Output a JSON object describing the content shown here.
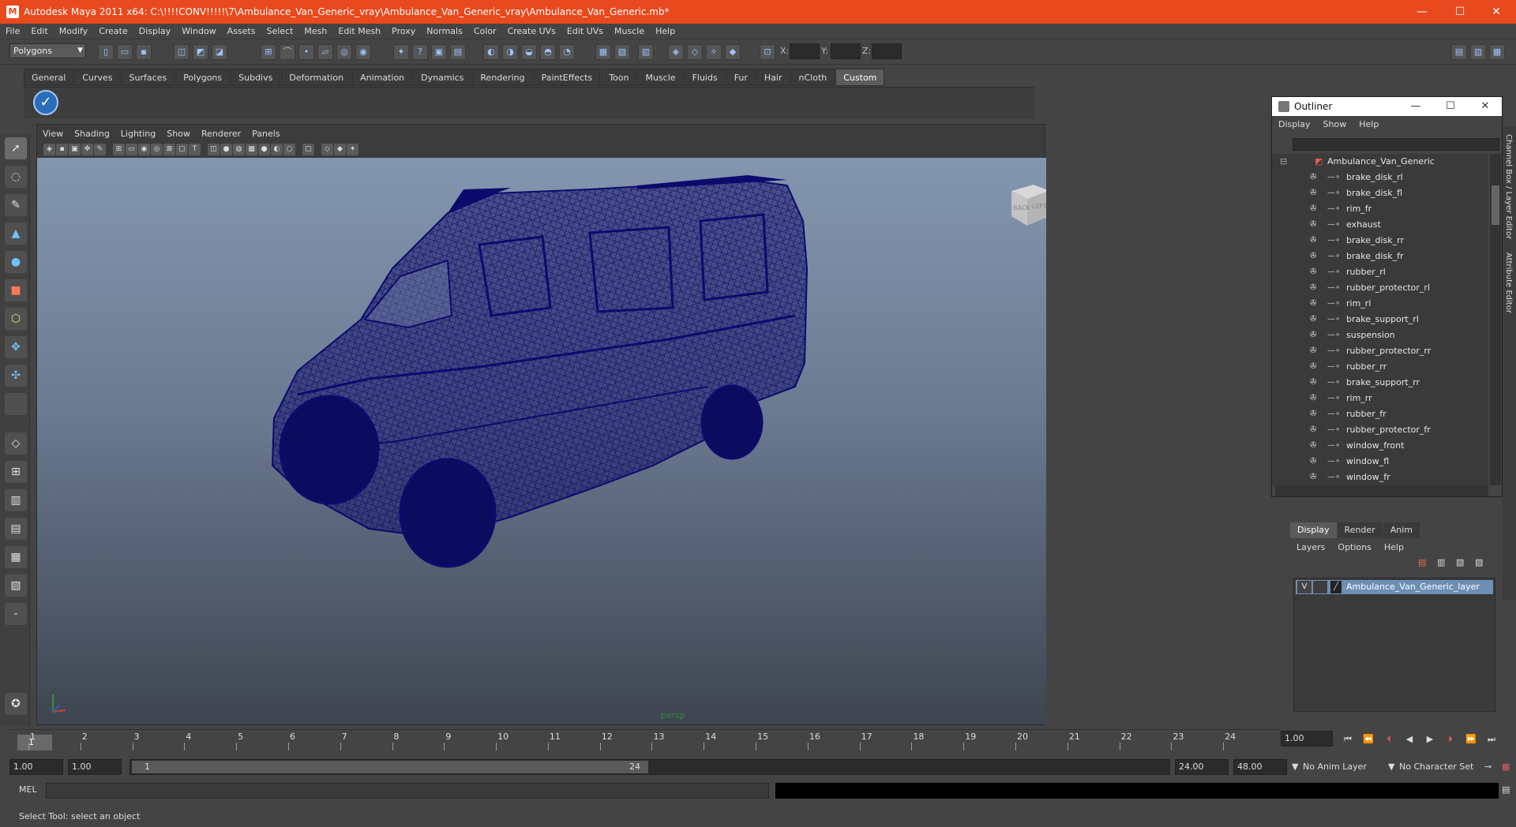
{
  "window": {
    "title": "Autodesk Maya 2011 x64: C:\\!!!!CONV!!!!!\\7\\Ambulance_Van_Generic_vray\\Ambulance_Van_Generic_vray\\Ambulance_Van_Generic.mb*",
    "minimize": "—",
    "maximize": "☐",
    "close": "✕"
  },
  "menubar": [
    "File",
    "Edit",
    "Modify",
    "Create",
    "Display",
    "Window",
    "Assets",
    "Select",
    "Mesh",
    "Edit Mesh",
    "Proxy",
    "Normals",
    "Color",
    "Create UVs",
    "Edit UVs",
    "Muscle",
    "Help"
  ],
  "statusline": {
    "mode": "Polygons",
    "x_label": "X:",
    "y_label": "Y:",
    "z_label": "Z:"
  },
  "shelf_tabs": [
    "General",
    "Curves",
    "Surfaces",
    "Polygons",
    "Subdivs",
    "Deformation",
    "Animation",
    "Dynamics",
    "Rendering",
    "PaintEffects",
    "Toon",
    "Muscle",
    "Fluids",
    "Fur",
    "Hair",
    "nCloth",
    "Custom"
  ],
  "shelf_active_tab": "Custom",
  "viewport": {
    "menu": [
      "View",
      "Shading",
      "Lighting",
      "Show",
      "Renderer",
      "Panels"
    ],
    "camera": "persp",
    "viewcube_back": "BACK",
    "viewcube_left": "LEFT",
    "wire_color": "#0b0b6e"
  },
  "outliner": {
    "title": "Outliner",
    "menu": [
      "Display",
      "Show",
      "Help"
    ],
    "root": "Ambulance_Van_Generic",
    "items": [
      "brake_disk_rl",
      "brake_disk_fl",
      "rim_fr",
      "exhaust",
      "brake_disk_rr",
      "brake_disk_fr",
      "rubber_rl",
      "rubber_protector_rl",
      "rim_rl",
      "brake_support_rl",
      "suspension",
      "rubber_protector_rr",
      "rubber_rr",
      "brake_support_rr",
      "rim_rr",
      "rubber_fr",
      "rubber_protector_fr",
      "window_front",
      "window_fl",
      "window_fr"
    ]
  },
  "layer_editor": {
    "tabs": [
      "Display",
      "Render",
      "Anim"
    ],
    "active_tab": "Display",
    "menu": [
      "Layers",
      "Options",
      "Help"
    ],
    "layer_visible": "V",
    "layer_name": "Ambulance_Van_Generic_layer"
  },
  "side_tabs": [
    "Channel Box / Layer Editor",
    "Attribute Editor"
  ],
  "timeline": {
    "current_frame": "1",
    "ticks": [
      "1",
      "2",
      "3",
      "4",
      "5",
      "6",
      "7",
      "8",
      "9",
      "10",
      "11",
      "12",
      "13",
      "14",
      "15",
      "16",
      "17",
      "18",
      "19",
      "20",
      "21",
      "22",
      "23",
      "24"
    ],
    "current_time_field": "1.00"
  },
  "range": {
    "start_time": "1.00",
    "playback_start": "1.00",
    "range_start": "1",
    "range_end": "24",
    "playback_end": "24.00",
    "end_time": "48.00",
    "anim_layer": "No Anim Layer",
    "character_set": "No Character Set"
  },
  "command_line": {
    "label": "MEL"
  },
  "help_line": "Select Tool: select an object"
}
